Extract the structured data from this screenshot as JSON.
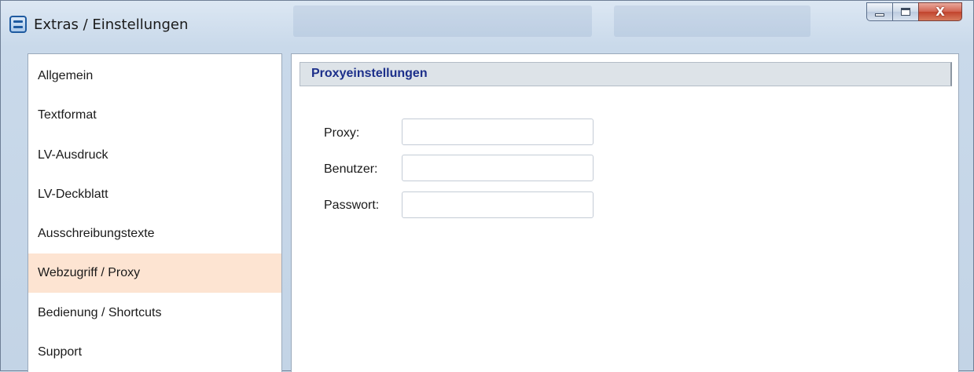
{
  "window": {
    "title": "Extras / Einstellungen",
    "close_glyph": "X"
  },
  "sidebar": {
    "items": [
      {
        "label": "Allgemein",
        "active": false
      },
      {
        "label": "Textformat",
        "active": false
      },
      {
        "label": "LV-Ausdruck",
        "active": false
      },
      {
        "label": "LV-Deckblatt",
        "active": false
      },
      {
        "label": "Ausschreibungstexte",
        "active": false
      },
      {
        "label": "Webzugriff / Proxy",
        "active": true
      },
      {
        "label": "Bedienung / Shortcuts",
        "active": false
      },
      {
        "label": "Support",
        "active": false
      }
    ]
  },
  "proxy": {
    "section_title": "Proxyeinstellungen",
    "fields": [
      {
        "label": "Proxy:",
        "value": "",
        "placeholder": ""
      },
      {
        "label": "Benutzer:",
        "value": "",
        "placeholder": ""
      },
      {
        "label": "Passwort:",
        "value": "",
        "placeholder": ""
      }
    ]
  },
  "colors": {
    "active_item": "#fde4d2",
    "section_title": "#1c2f8a",
    "close_button": "#c2432d"
  }
}
